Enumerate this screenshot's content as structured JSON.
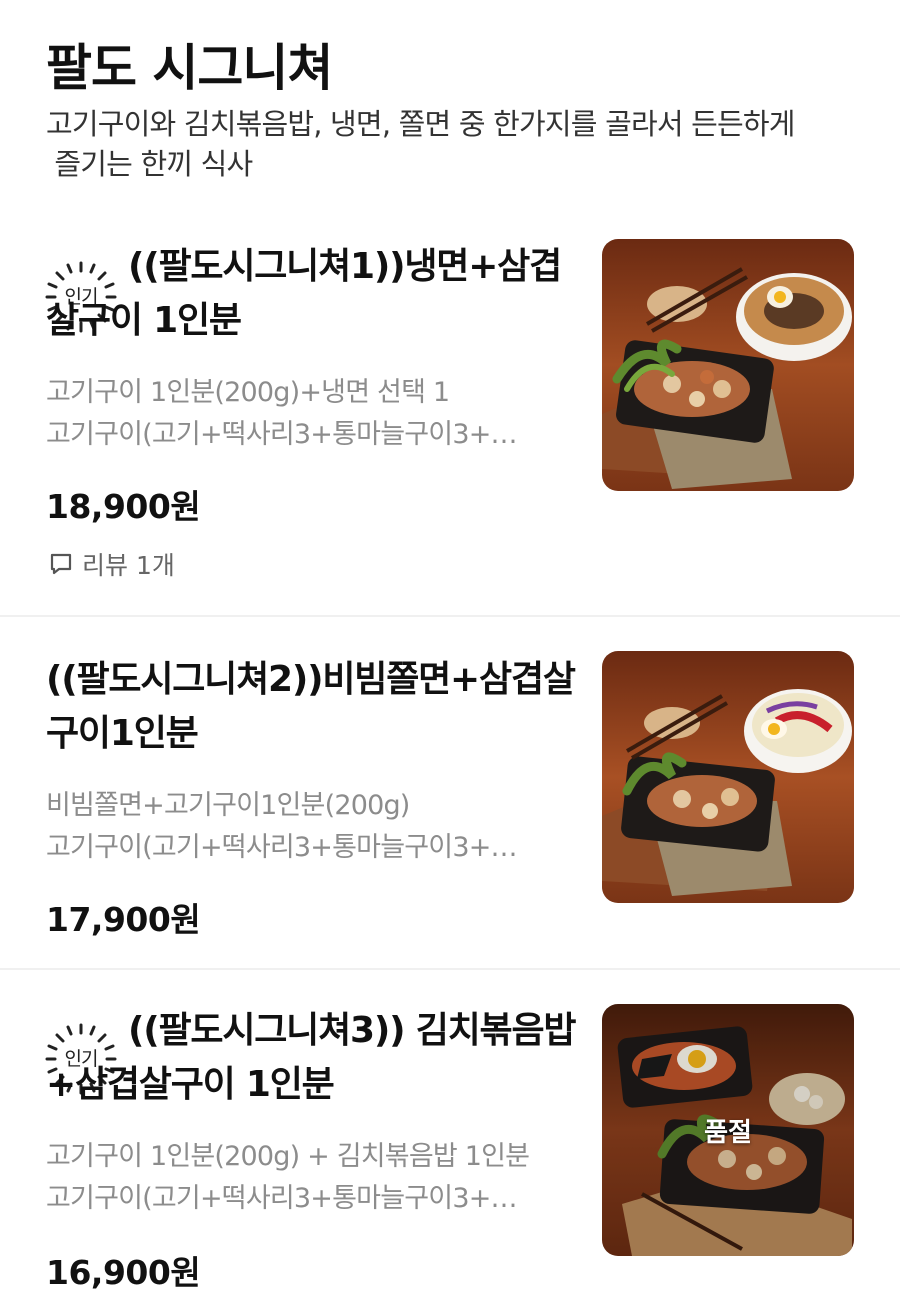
{
  "section": {
    "title": "팔도 시그니쳐",
    "description_line1": "고기구이와 김치볶음밥, 냉면, 쫄면 중 한가지를 골라서 든든하게",
    "description_line2": " 즐기는 한끼 식사"
  },
  "items": [
    {
      "badge": "인기",
      "name": "((팔도시그니쳐1))냉면+삼겹살구이 1인분",
      "desc_line1": "고기구이 1인분(200g)+냉면 선택 1",
      "desc_line2": "고기구이(고기+떡사리3+통마늘구이3+…",
      "price": "18,900원",
      "review": "리뷰 1개"
    },
    {
      "name": "((팔도시그니쳐2))비빔쫄면+삼겹살구이1인분",
      "desc_line1": "비빔쫄면+고기구이1인분(200g)",
      "desc_line2": "고기구이(고기+떡사리3+통마늘구이3+…",
      "price": "17,900원"
    },
    {
      "badge": "인기",
      "name": "((팔도시그니쳐3)) 김치볶음밥+삼겹살구이 1인분",
      "desc_line1": "고기구이 1인분(200g) + 김치볶음밥 1인분",
      "desc_line2": "고기구이(고기+떡사리3+통마늘구이3+…",
      "price": "16,900원",
      "status": "품절"
    }
  ],
  "colors": {
    "wood": "#8a3e1c",
    "tray": "#1e1a18",
    "greens": "#5e8a2e",
    "text_muted": "#8c8c8c"
  },
  "icons": {
    "badge": "popular-burst-badge",
    "review": "speech-bubble-icon"
  }
}
